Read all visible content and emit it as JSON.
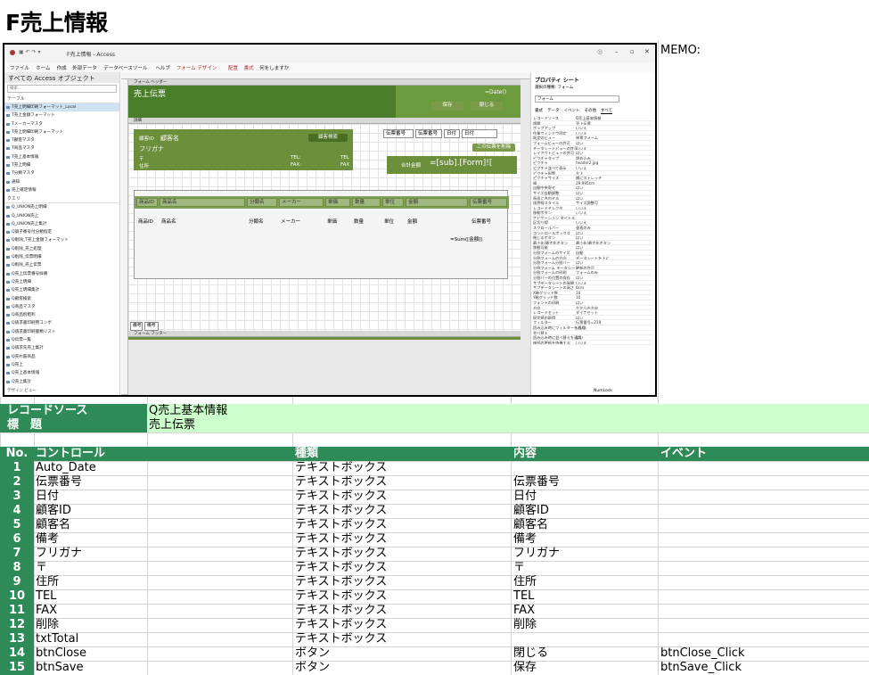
{
  "page_title": "F売上情報",
  "memo_label": "MEMO:",
  "access": {
    "window_title": "F売上情報 - Access",
    "menu": [
      "ファイル",
      "ホーム",
      "作成",
      "外部データ",
      "データベースツール",
      "ヘルプ",
      "フォーム デザイン",
      "配置",
      "書式",
      "何をしますか"
    ],
    "nav_header": "すべての Access オブジェクト",
    "nav_search": "検索...",
    "nav_group_tables": "テーブル",
    "nav_tables": [
      "T売上明細印刷フォーマット_Local",
      "T売上金額フォーマット",
      "Tメーカーマスタ",
      "T売上明細印刷フォーマット",
      "T顧客マスタ",
      "T商品マスタ",
      "T売上基本情報",
      "T売上明細",
      "T分類マスタ",
      "通知",
      "売上確定情報"
    ],
    "nav_group_queries": "クエリ",
    "nav_queries": [
      "Q_UNION売上明細",
      "Q_UNION売上",
      "Q_UNION売上集計",
      "Q調子番号付分類指定",
      "Q削除_T売上金額フォーマット",
      "Q削除_売上処理",
      "Q削除_伝票明細",
      "Q削除_売上伝票",
      "Q売上伝票番号採番",
      "Q売上明細",
      "Q売上明細集計",
      "Q顧客検索",
      "Q商品マスタ",
      "Q商品別粗利",
      "Q請求書印刷用コンボ",
      "Q請求書印刷書類リスト",
      "Q伝票一覧",
      "Q請求先売上集計",
      "Q売れ筋商品",
      "Q売上",
      "Q売上基本情報",
      "Q売上集計"
    ],
    "status_left": "デザイン ビュー",
    "status_right": "NumLock",
    "form_header_label": "フォーム ヘッダー",
    "form_title": "売上伝票",
    "date_expr": "=Date()",
    "save_btn": "保存",
    "close_btn": "閉じる",
    "detail_label": "詳細",
    "customer_id": "顧客ID",
    "customer_name": "顧客名",
    "furigana": "フリガナ",
    "zip": "〒",
    "address": "住所",
    "tel": "TEL:",
    "tel_f": "TEL",
    "fax": "FAX:",
    "fax_f": "FAX",
    "cust_search_btn": "顧客検索",
    "slip_no": "伝票番号",
    "date": "日付",
    "delete_btn": "この伝票を削除",
    "total_label": "合計金額",
    "total_expr": "=[sub].[Form]![",
    "sub_columns": [
      "商品ID",
      "商品名",
      "分類名",
      "メーカー",
      "単価",
      "数量",
      "単位",
      "金額",
      "伝票番号"
    ],
    "sum_expr": "=Sum([金額])",
    "remarks": "備考",
    "footer_label": "フォーム フッター",
    "props_title": "プロパティ シート",
    "props_sel": "選択の種類: フォーム",
    "props_combo": "フォーム",
    "props_tabs": [
      "書式",
      "データ",
      "イベント",
      "その他",
      "すべて"
    ],
    "props": [
      [
        "レコードソース",
        "Q売上基本情報"
      ],
      [
        "標題",
        "売上伝票"
      ],
      [
        "ポップアップ",
        "いいえ"
      ],
      [
        "作業ウィンドウ固定",
        "いいえ"
      ],
      [
        "既定のビュー",
        "単票フォーム"
      ],
      [
        "フォームビューの許可",
        "はい"
      ],
      [
        "データシートビューの許可",
        "いいえ"
      ],
      [
        "レイアウトビューの許可",
        "はい"
      ],
      [
        "ピクチャタイプ",
        "埋め込み"
      ],
      [
        "ピクチャ",
        "header2.jpg"
      ],
      [
        "ピクチャ並べて表示",
        "いいえ"
      ],
      [
        "ピクチャ配置",
        "左上"
      ],
      [
        "ピクチャサイズ",
        "横にストレッチ"
      ],
      [
        "幅",
        "29.995cm"
      ],
      [
        "自動中央寄せ",
        "はい"
      ],
      [
        "サイズ自動調整",
        "はい"
      ],
      [
        "画面に合わせる",
        "はい"
      ],
      [
        "境界線スタイル",
        "サイズ調整可"
      ],
      [
        "レコードセレクタ",
        "いいえ"
      ],
      [
        "移動ボタン",
        "いいえ"
      ],
      [
        "ナビゲーション タイトル",
        ""
      ],
      [
        "区切り線",
        "いいえ"
      ],
      [
        "スクロールバー",
        "垂直のみ"
      ],
      [
        "コントロールボックス",
        "はい"
      ],
      [
        "閉じるボタン",
        "はい"
      ],
      [
        "最小化/最大化ボタン",
        "最小化/最大化ボタン"
      ],
      [
        "移動可能",
        "はい"
      ],
      [
        "分割フォームのサイズ",
        "自動"
      ],
      [
        "分割フォームの方向",
        "データシートを上に"
      ],
      [
        "分割フォーム分割バー",
        "はい"
      ],
      [
        "分割フォーム データシート",
        "更新の許可"
      ],
      [
        "分割フォームの印刷",
        "フォームのみ"
      ],
      [
        "分割バーの位置の保存",
        "はい"
      ],
      [
        "サブデータシートの展開",
        "いいえ"
      ],
      [
        "サブデータシートの高さ",
        "0cm"
      ],
      [
        "X軸グリッド数",
        "10"
      ],
      [
        "Y軸グリッド数",
        "10"
      ],
      [
        "フォントの印刷",
        "はい"
      ],
      [
        "方向",
        "左から右方向"
      ],
      [
        "レコードセット",
        "ダイナセット"
      ],
      [
        "既定値の取得",
        "はい"
      ],
      [
        "フィルター",
        "伝票番号=219"
      ],
      [
        "読み込み時にフィルターを適用",
        "いいえ"
      ],
      [
        "並べ替え",
        ""
      ],
      [
        "読み込み時に並べ替えを適用",
        "はい"
      ],
      [
        "後続の更新を待機する",
        "いいえ"
      ]
    ]
  },
  "info": {
    "record_source_label": "レコードソース",
    "record_source_value": "Q売上基本情報",
    "caption_label": "標　題",
    "caption_value": "売上伝票"
  },
  "table": {
    "headers": [
      "No.",
      "コントロール",
      "種類",
      "内容",
      "イベント"
    ],
    "rows": [
      [
        "1",
        "Auto_Date",
        "テキストボックス",
        "",
        ""
      ],
      [
        "2",
        "伝票番号",
        "テキストボックス",
        "伝票番号",
        ""
      ],
      [
        "3",
        "日付",
        "テキストボックス",
        "日付",
        ""
      ],
      [
        "4",
        "顧客ID",
        "テキストボックス",
        "顧客ID",
        ""
      ],
      [
        "5",
        "顧客名",
        "テキストボックス",
        "顧客名",
        ""
      ],
      [
        "6",
        "備考",
        "テキストボックス",
        "備考",
        ""
      ],
      [
        "7",
        "フリガナ",
        "テキストボックス",
        "フリガナ",
        ""
      ],
      [
        "8",
        "〒",
        "テキストボックス",
        "〒",
        ""
      ],
      [
        "9",
        "住所",
        "テキストボックス",
        "住所",
        ""
      ],
      [
        "10",
        "TEL",
        "テキストボックス",
        "TEL",
        ""
      ],
      [
        "11",
        "FAX",
        "テキストボックス",
        "FAX",
        ""
      ],
      [
        "12",
        "削除",
        "テキストボックス",
        "削除",
        ""
      ],
      [
        "13",
        "txtTotal",
        "テキストボックス",
        "",
        ""
      ],
      [
        "14",
        "btnClose",
        "ボタン",
        "閉じる",
        "btnClose_Click"
      ],
      [
        "15",
        "btnSave",
        "ボタン",
        "保存",
        "btnSave_Click"
      ]
    ]
  }
}
